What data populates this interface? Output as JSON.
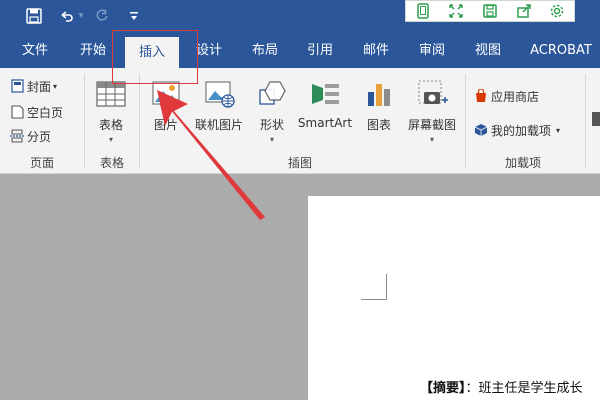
{
  "quick_access": {
    "icons": [
      "save-icon",
      "undo-icon",
      "redo-icon",
      "customize-icon"
    ]
  },
  "float_toolbar": {
    "icons": [
      "phone-icon",
      "expand-icon",
      "save-icon",
      "share-icon",
      "settings-icon"
    ],
    "color": "#2e9e4f"
  },
  "tabs": [
    {
      "label": "文件"
    },
    {
      "label": "开始"
    },
    {
      "label": "插入"
    },
    {
      "label": "设计"
    },
    {
      "label": "布局"
    },
    {
      "label": "引用"
    },
    {
      "label": "邮件"
    },
    {
      "label": "审阅"
    },
    {
      "label": "视图"
    },
    {
      "label": "ACROBAT"
    }
  ],
  "ribbon": {
    "pages": {
      "cover": "封面",
      "blank": "空白页",
      "break": "分页",
      "group": "页面"
    },
    "table": {
      "button": "表格",
      "group": "表格"
    },
    "illustrations": {
      "picture": "图片",
      "online_picture": "联机图片",
      "shapes": "形状",
      "smartart": "SmartArt",
      "chart": "图表",
      "screenshot": "屏幕截图",
      "group": "插图"
    },
    "addins": {
      "store": "应用商店",
      "my_addins": "我的加载项",
      "group": "加载项"
    }
  },
  "document": {
    "abstract_label": "【摘要】",
    "abstract_text": "：班主任是学生成长"
  },
  "colors": {
    "accent": "#2b579a",
    "highlight": "#e0393b"
  }
}
